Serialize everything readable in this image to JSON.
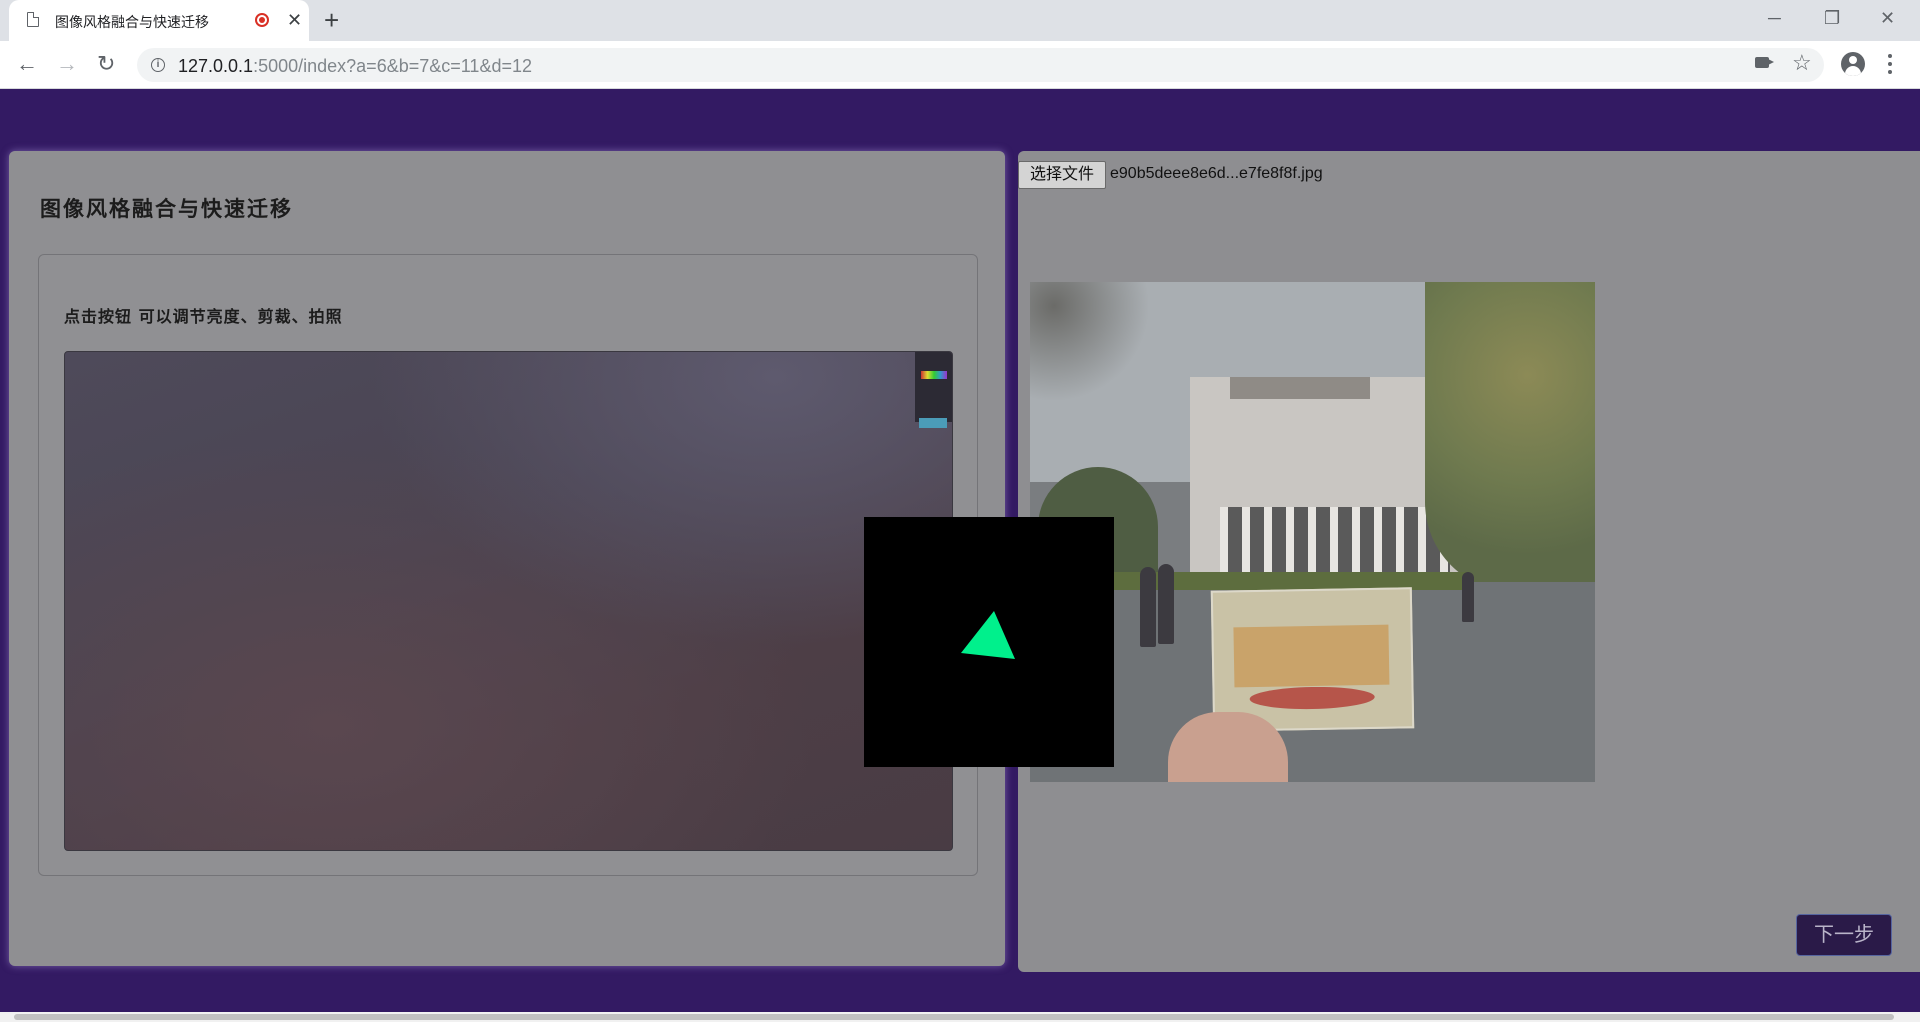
{
  "browser": {
    "tab_title": "图像风格融合与快速迁移",
    "close_tab_symbol": "✕",
    "new_tab_symbol": "+",
    "url_host": "127.0.0.1",
    "url_rest": ":5000/index?a=6&b=7&c=11&d=12",
    "window_controls": {
      "minimize": "─",
      "restore": "❐",
      "close": "✕"
    },
    "nav": {
      "back": "←",
      "forward": "→",
      "reload": "↻",
      "star": "☆"
    },
    "icons": {
      "page": "page-icon",
      "recording": "recording-icon",
      "info": "info-icon",
      "camera": "camera-icon",
      "profile": "profile-icon",
      "menu": "menu-icon"
    }
  },
  "left_panel": {
    "heading": "图像风格融合与快速迁移",
    "hint": "点击按钮 可以调节亮度、剪裁、拍照"
  },
  "right_panel": {
    "file_button_label": "选择文件",
    "file_name": "e90b5deee8e6d...e7fe8f8f.jpg",
    "next_button_label": "下一步"
  },
  "colors": {
    "page_background": "#331a63",
    "panel_background": "#8f8f92",
    "triangle": "#00f08c",
    "overlay": "#000000"
  }
}
